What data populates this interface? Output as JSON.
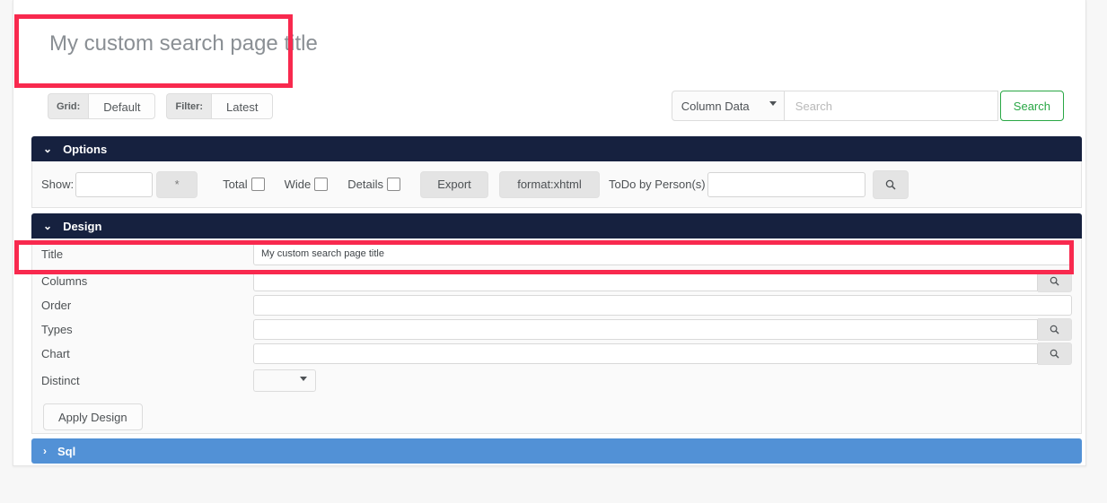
{
  "page": {
    "title": "My custom search page title"
  },
  "toolbar": {
    "grid": {
      "label": "Grid:",
      "value": "Default"
    },
    "filter": {
      "label": "Filter:",
      "value": "Latest"
    }
  },
  "search": {
    "scope_selected": "Column Data",
    "scope_options": [
      "Column Data"
    ],
    "placeholder": "Search",
    "value": "",
    "button_label": "Search",
    "button_color": "#29a745"
  },
  "options": {
    "header": "Options",
    "chevron": "⌄",
    "show_label": "Show:",
    "show_value": "",
    "star_button": "*",
    "total_label": "Total",
    "wide_label": "Wide",
    "details_label": "Details",
    "export_label": "Export",
    "format_label": "format:xhtml",
    "todo_label": "ToDo by Person(s)",
    "todo_value": "",
    "search_icon": "search-icon"
  },
  "design": {
    "header": "Design",
    "chevron": "⌄",
    "rows": [
      {
        "label": "Title",
        "value": "My custom search page title",
        "has_magnifier": false,
        "type": "text"
      },
      {
        "label": "Columns",
        "value": "",
        "has_magnifier": true,
        "type": "text"
      },
      {
        "label": "Order",
        "value": "",
        "has_magnifier": false,
        "type": "text"
      },
      {
        "label": "Types",
        "value": "",
        "has_magnifier": true,
        "type": "text"
      },
      {
        "label": "Chart",
        "value": "",
        "has_magnifier": true,
        "type": "text"
      },
      {
        "label": "Distinct",
        "value": "",
        "has_magnifier": false,
        "type": "select"
      }
    ],
    "apply_label": "Apply Design"
  },
  "sql": {
    "header": "Sql",
    "chevron": "›",
    "color": "#5291d6"
  },
  "annotations": {
    "color": "#f8294e",
    "boxes": [
      "title-header-highlight",
      "design-title-row-highlight"
    ]
  }
}
